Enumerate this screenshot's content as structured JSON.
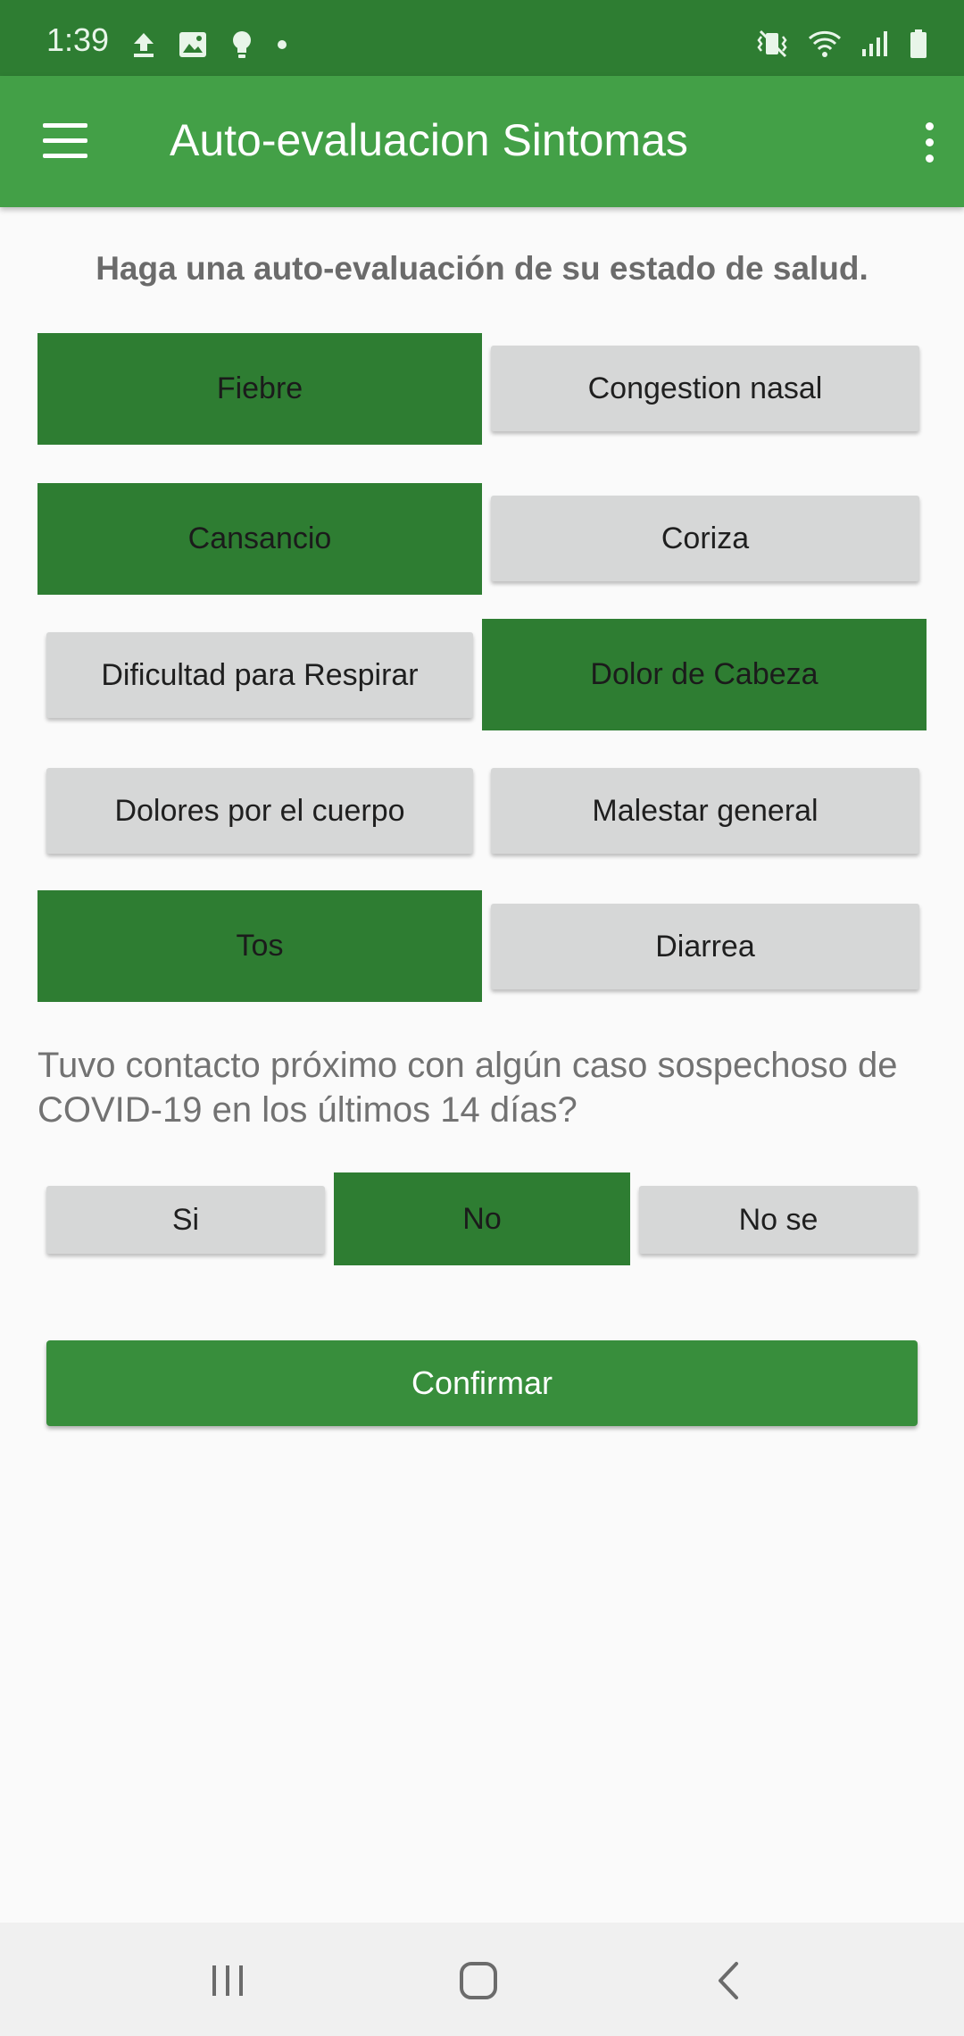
{
  "status_bar": {
    "time": "1:39",
    "left_icons": [
      "upload-icon",
      "image-icon",
      "bulb-icon",
      "dot-icon"
    ],
    "right_icons": [
      "mute-vibrate-icon",
      "wifi-icon",
      "signal-icon",
      "battery-icon"
    ]
  },
  "app_bar": {
    "title": "Auto-evaluacion Sintomas",
    "menu_icon": "hamburger-menu-icon",
    "overflow_icon": "more-vert-icon"
  },
  "prompt": "Haga una auto-evaluación de su estado de salud.",
  "symptoms": [
    {
      "label": "Fiebre",
      "selected": true
    },
    {
      "label": "Congestion nasal",
      "selected": false
    },
    {
      "label": "Cansancio",
      "selected": true
    },
    {
      "label": "Coriza",
      "selected": false
    },
    {
      "label": "Dificultad para Respirar",
      "selected": false
    },
    {
      "label": "Dolor de Cabeza",
      "selected": true
    },
    {
      "label": "Dolores por el cuerpo",
      "selected": false
    },
    {
      "label": "Malestar general",
      "selected": false
    },
    {
      "label": "Tos",
      "selected": true
    },
    {
      "label": "Diarrea",
      "selected": false
    }
  ],
  "contact_question": "Tuvo contacto próximo con algún caso sospechoso de COVID-19 en los últimos 14 días?",
  "contact_options": [
    {
      "label": "Si",
      "selected": false
    },
    {
      "label": "No",
      "selected": true
    },
    {
      "label": "No se",
      "selected": false
    }
  ],
  "confirm_label": "Confirmar",
  "nav_bar": {
    "icons": [
      "recent-apps-icon",
      "home-icon",
      "back-icon"
    ]
  },
  "colors": {
    "status_bar": "#2e7d32",
    "app_bar": "#43a047",
    "selected": "#2e7d32",
    "unselected": "#d6d7d7",
    "confirm": "#388e3c"
  }
}
